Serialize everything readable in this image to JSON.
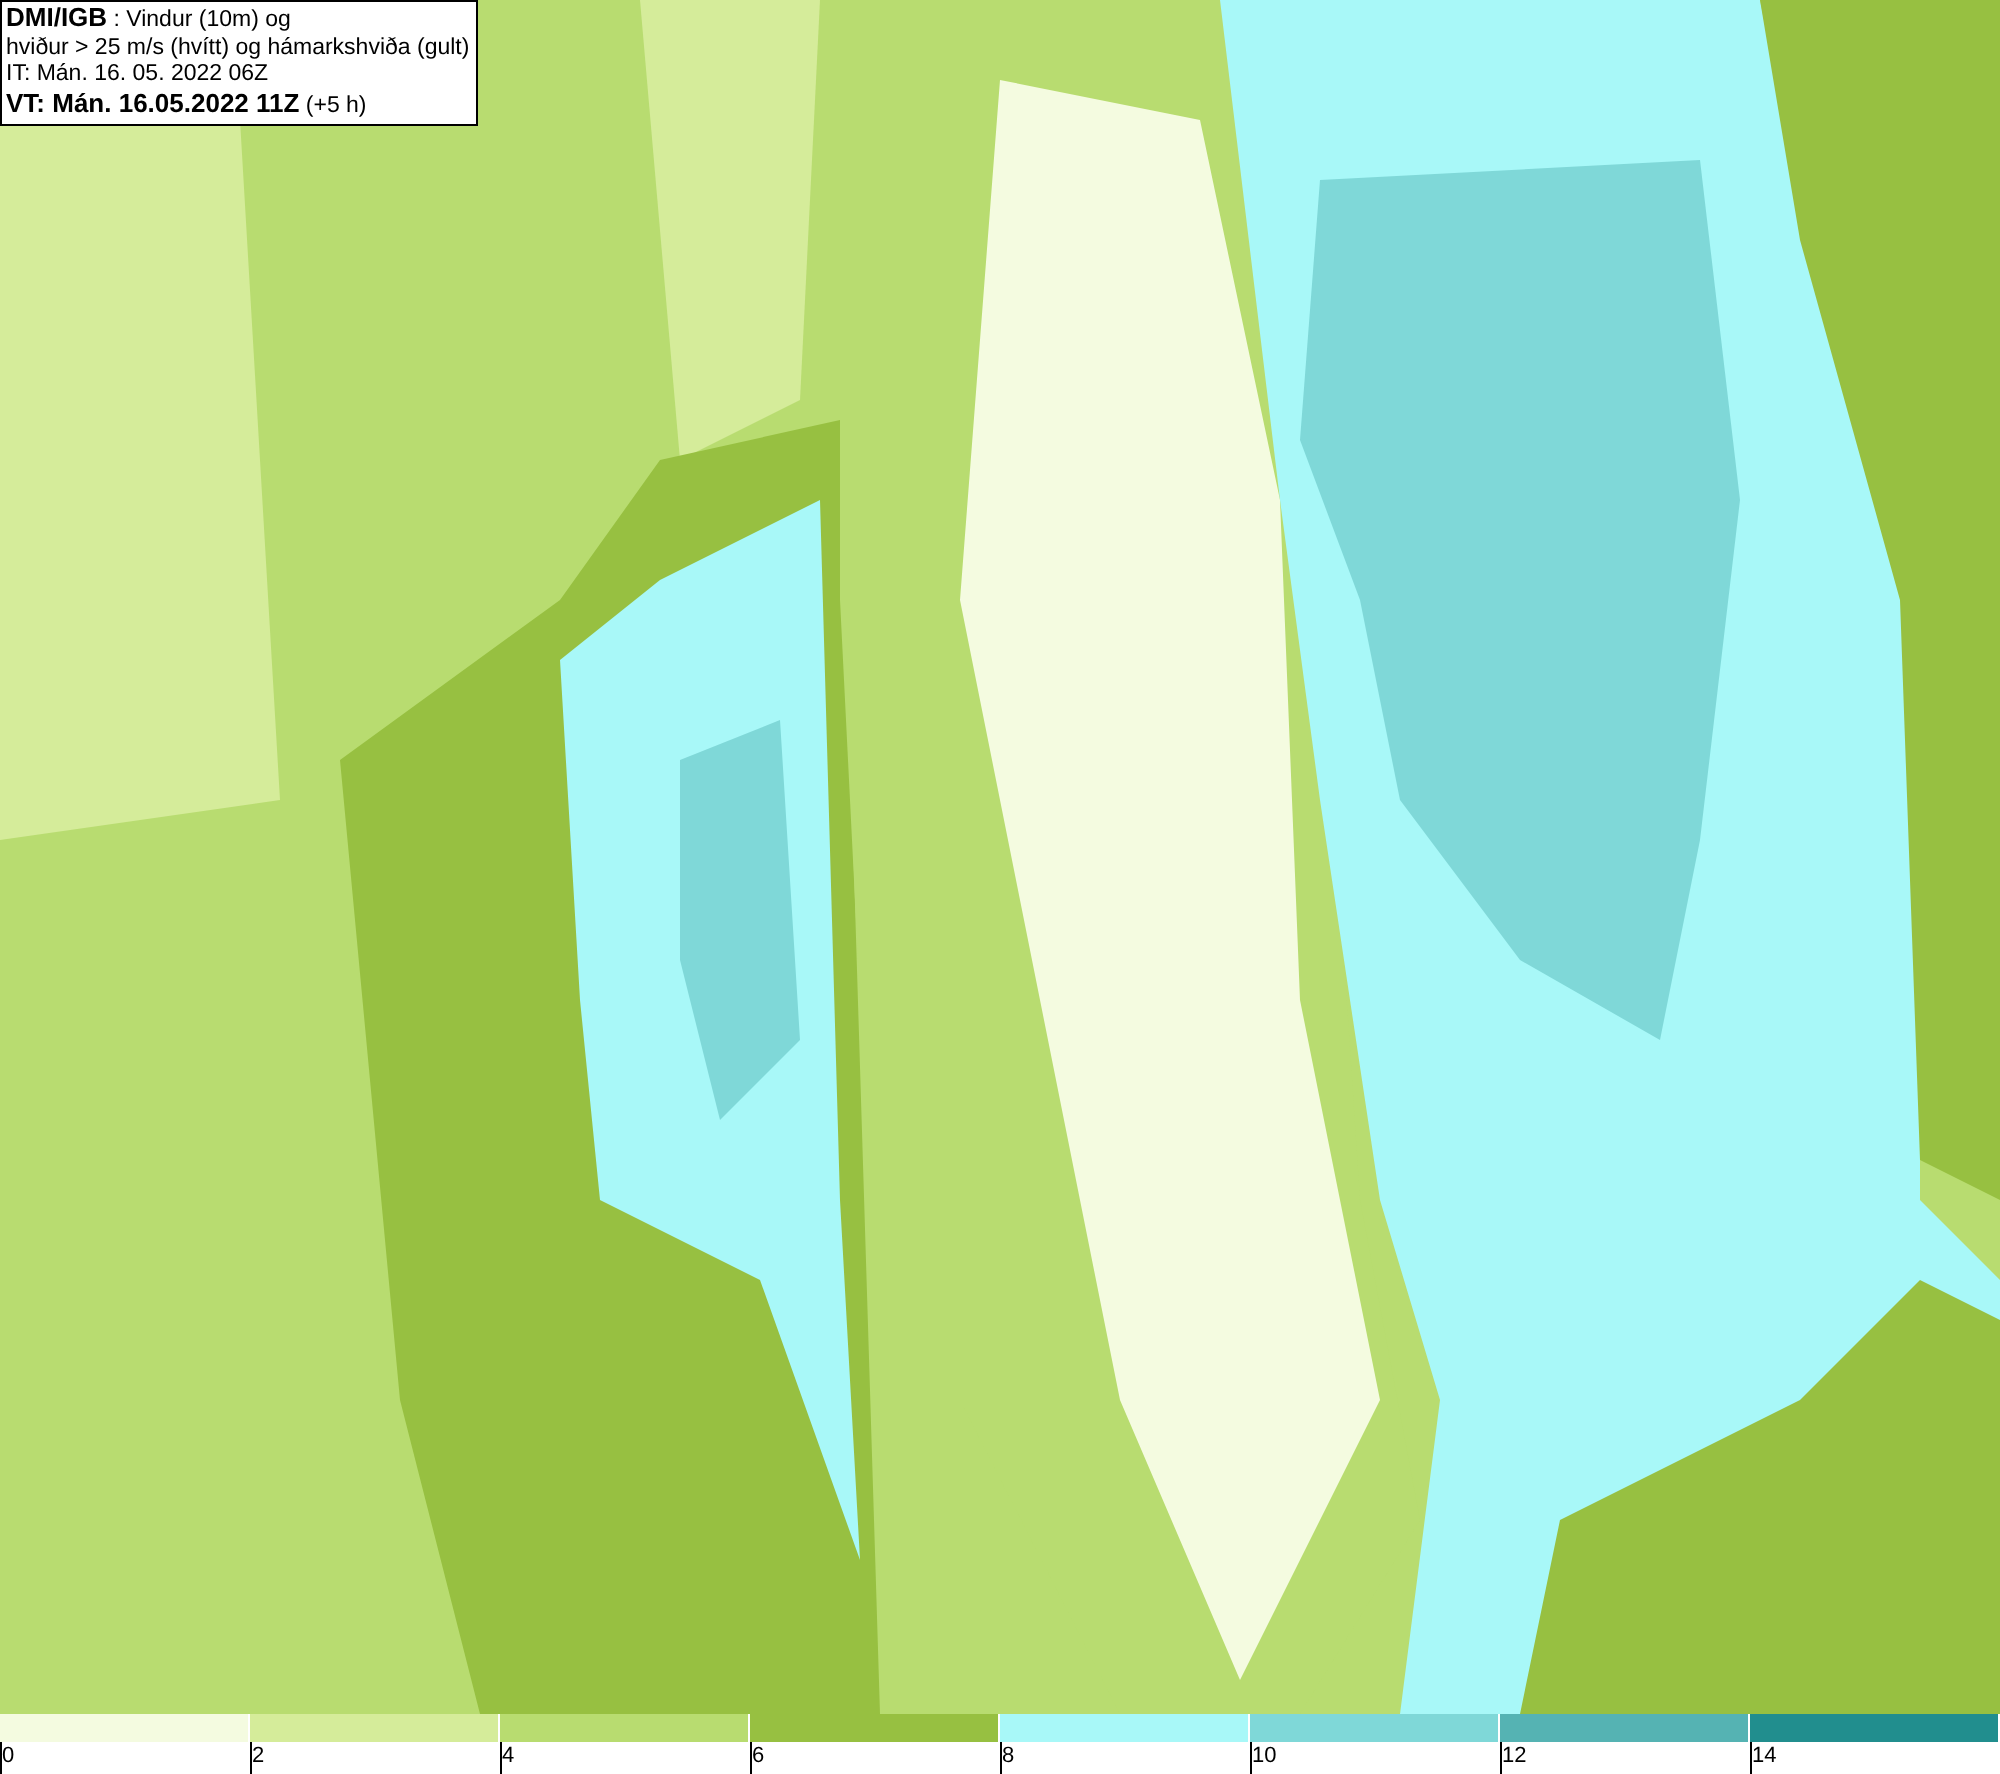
{
  "title_box": {
    "lines": [
      "**DMI/IGB** : Vindur (10m) og",
      "hviður > 25 m/s (hvítt) og hámarkshviða (gult)",
      "IT: Mán. 16. 05. 2022 06Z",
      "**VT: Mán. 16.05.2022 11Z** (+5 h)"
    ]
  },
  "legend": {
    "bins": [
      {
        "label": "0",
        "color": "#f4fbe0"
      },
      {
        "label": "2",
        "color": "#d5ec9a"
      },
      {
        "label": "4",
        "color": "#b8dc70"
      },
      {
        "label": "6",
        "color": "#97c041"
      },
      {
        "label": "8",
        "color": "#a8f8f8"
      },
      {
        "label": "10",
        "color": "#7fd8d8"
      },
      {
        "label": "12",
        "color": "#55b3b3"
      },
      {
        "label": "14",
        "color": "#218e8e"
      }
    ]
  }
}
